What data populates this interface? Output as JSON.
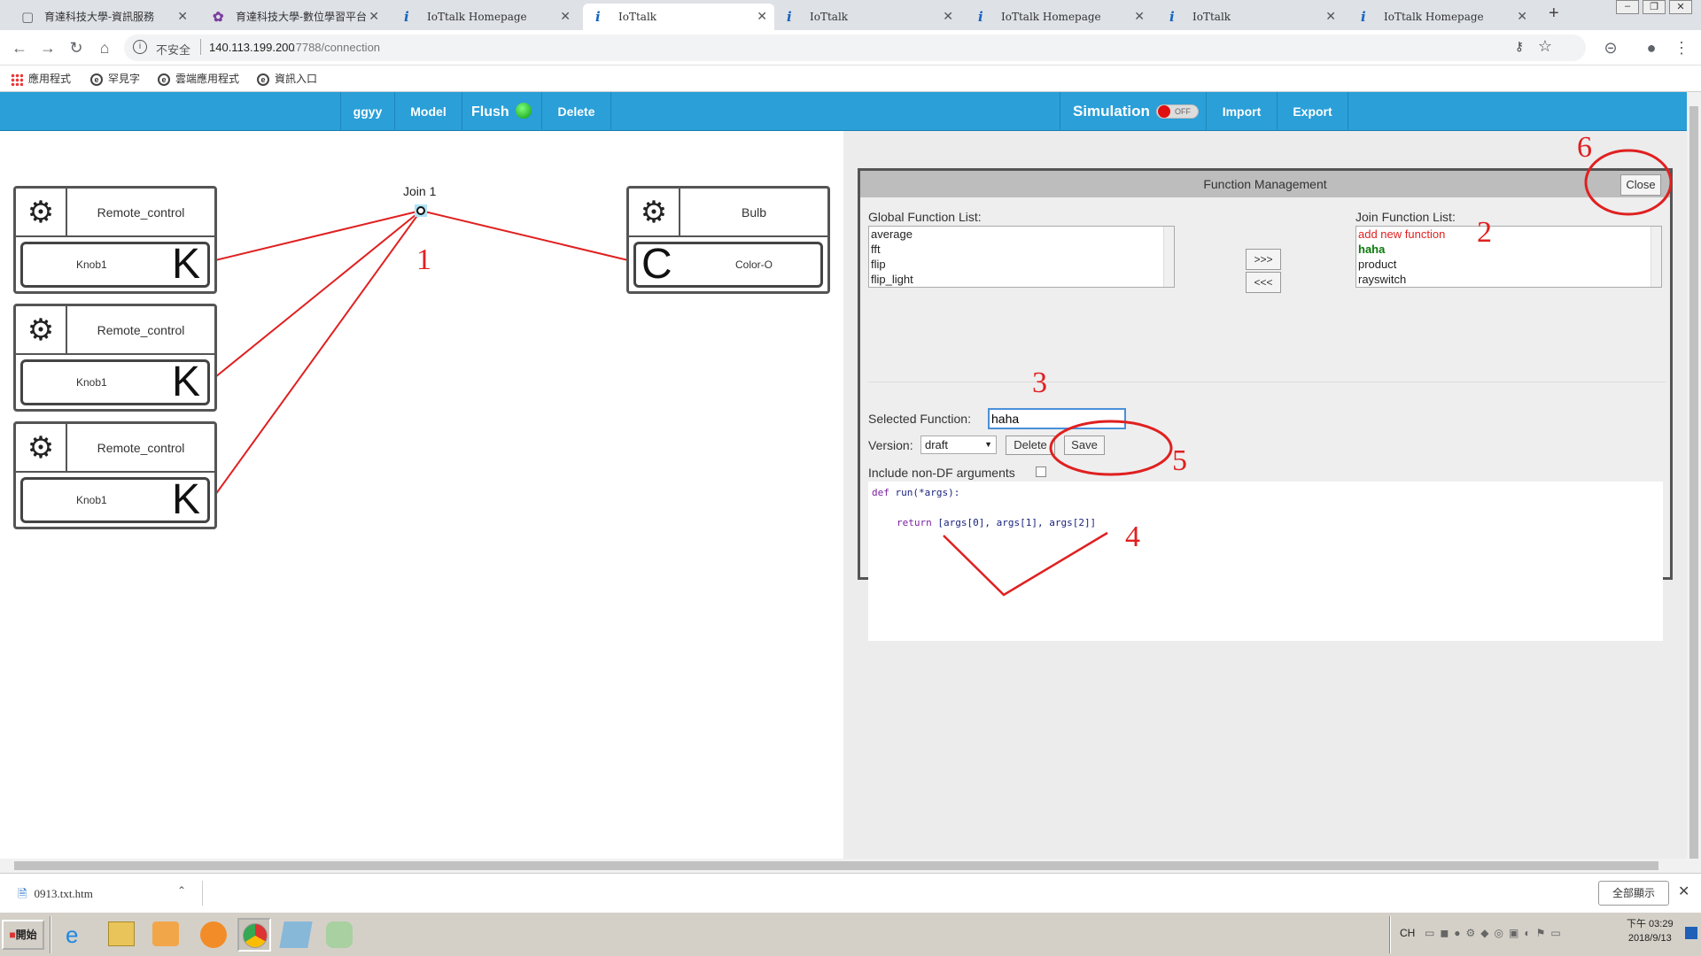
{
  "browser": {
    "tabs": [
      {
        "title": "育達科技大學-資訊服務"
      },
      {
        "title": "育達科技大學-數位學習平台"
      },
      {
        "title": "IoTtalk Homepage"
      },
      {
        "title": "IoTtalk",
        "active": true
      },
      {
        "title": "IoTtalk"
      },
      {
        "title": "IoTtalk Homepage"
      },
      {
        "title": "IoTtalk"
      },
      {
        "title": "IoTtalk Homepage"
      }
    ],
    "security_label": "不安全",
    "url_host": "140.113.199.200",
    "url_path": ":7788/connection",
    "bookmarks": [
      "應用程式",
      "罕見字",
      "雲端應用程式",
      "資訊入口"
    ]
  },
  "nav": {
    "project": "ggyy",
    "model": "Model",
    "flush": "Flush",
    "delete": "Delete",
    "simulation": "Simulation",
    "sim_state": "OFF",
    "import": "Import",
    "export": "Export"
  },
  "canvas": {
    "join_label": "Join 1",
    "inputs": [
      {
        "device": "Remote_control",
        "feature": "Knob1",
        "letter": "K"
      },
      {
        "device": "Remote_control",
        "feature": "Knob1",
        "letter": "K"
      },
      {
        "device": "Remote_control",
        "feature": "Knob1",
        "letter": "K"
      }
    ],
    "output": {
      "device": "Bulb",
      "feature": "Color-O",
      "letter": "C"
    }
  },
  "fm": {
    "title": "Function Management",
    "close": "Close",
    "global_label": "Global Function List:",
    "global_items": [
      "average",
      "fft",
      "flip",
      "flip_light"
    ],
    "join_label": "Join Function List:",
    "join_items": [
      "add new function",
      "haha",
      "product",
      "rayswitch"
    ],
    "move_right": ">>>",
    "move_left": "<<<",
    "selected_label": "Selected Function:",
    "selected_value": "haha",
    "version_label": "Version:",
    "version_value": "draft",
    "delete": "Delete",
    "save": "Save",
    "include_label": "Include non-DF arguments",
    "code_def": "def",
    "code_run": "run(*args):",
    "code_return": "return",
    "code_body": "[args[0], args[1], args[2]]"
  },
  "annotations": [
    "1",
    "2",
    "3",
    "4",
    "5",
    "6"
  ],
  "downloads": {
    "file": "0913.txt.htm",
    "show_all": "全部顯示"
  },
  "taskbar": {
    "start": "開始",
    "lang": "CH",
    "time": "下午 03:29",
    "date": "2018/9/13"
  },
  "colors": {
    "nav": "#2a9fd8",
    "link_line": "#e02020",
    "annotation": "#e02020"
  }
}
